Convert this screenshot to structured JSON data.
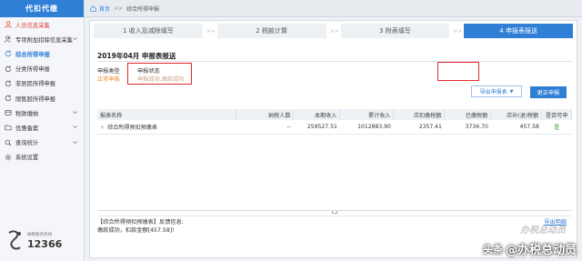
{
  "sidebar": {
    "brand": "代扣代缴",
    "items": [
      {
        "label": "人员信息采集",
        "icon": "user-icon",
        "style": "red"
      },
      {
        "label": "专项附加扣除信息采集",
        "icon": "users-icon",
        "arrow": true
      },
      {
        "label": "综合所得申报",
        "icon": "refresh-icon",
        "style": "active"
      },
      {
        "label": "分类所得申报",
        "icon": "refresh-icon"
      },
      {
        "label": "非居民所得申报",
        "icon": "refresh-icon"
      },
      {
        "label": "限售股所得申报",
        "icon": "refresh-icon"
      },
      {
        "label": "税款缴纳",
        "icon": "coin-icon",
        "arrow": true
      },
      {
        "label": "优惠备案",
        "icon": "folder-icon",
        "arrow": true
      },
      {
        "label": "查询统计",
        "icon": "search-icon",
        "arrow": true
      },
      {
        "label": "系统设置",
        "icon": "gear-icon"
      }
    ],
    "hotline_label": "纳税服务热线",
    "hotline_number": "12366"
  },
  "breadcrumb": {
    "home": "首页",
    "sep": ">>",
    "current": "综合所得申报"
  },
  "steps": [
    {
      "label": "1 收入及减除填写",
      "active": false
    },
    {
      "label": "2 税款计算",
      "active": false
    },
    {
      "label": "3 附表填写",
      "active": false
    },
    {
      "label": "4 申报表报送",
      "active": true
    }
  ],
  "step_separator": ">>",
  "section": {
    "title": "2019年04月  申报表报送"
  },
  "info": {
    "type_label": "申报类型",
    "type_value": "正常申报",
    "status_label": "申报状态",
    "status_value": "申报成功,缴款成功"
  },
  "buttons": {
    "export": "导出申报表",
    "correct": "更正申报"
  },
  "table": {
    "headers": [
      "报表名称",
      "纳税人数",
      "本期收入",
      "累计收入",
      "应扣缴税额",
      "已缴税额",
      "应补(退)税额",
      "是否可申"
    ],
    "rows": [
      {
        "name": "综合所得预扣预缴表",
        "count": "--",
        "income": "259527.51",
        "cumulative": "1012883.90",
        "tax_due": "2357.41",
        "tax_paid": "3734.70",
        "refund": "457.58",
        "can_declare": "是"
      }
    ]
  },
  "feedback": {
    "line1": "【综合所得预扣预缴表】反馈信息:",
    "line2": "缴款成功，扣款金额[457.58]!",
    "export_link": "导出明细"
  },
  "watermark": {
    "prefix": "头条",
    "text": "@办税总动员",
    "faint": "办税总动员"
  },
  "colors": {
    "primary": "#2f7fd6",
    "highlight_box": "#e02a2a",
    "orange": "#f08c2c",
    "red_text": "#e0463c"
  }
}
